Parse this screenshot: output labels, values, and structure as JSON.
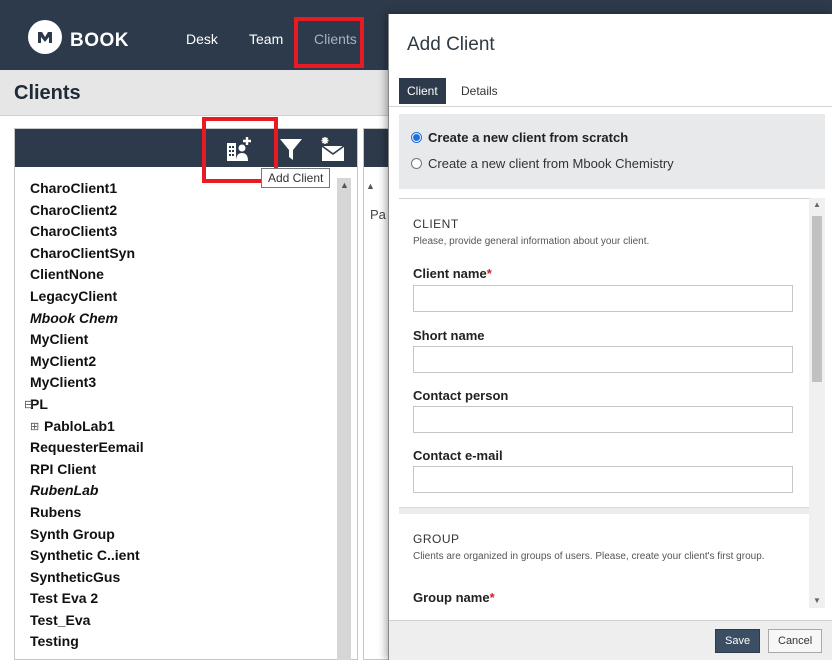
{
  "header": {
    "brand": "BOOK",
    "nav": [
      "Desk",
      "Team",
      "Clients"
    ]
  },
  "page": {
    "title": "Clients"
  },
  "toolbar": {
    "icons": [
      "add-client-icon",
      "filter-icon",
      "new-message-icon"
    ],
    "tooltip": "Add Client"
  },
  "clients": {
    "items": [
      {
        "label": "CharoClient1",
        "italic": false
      },
      {
        "label": "CharoClient2",
        "italic": false
      },
      {
        "label": "CharoClient3",
        "italic": false
      },
      {
        "label": "CharoClientSyn",
        "italic": false
      },
      {
        "label": "ClientNone",
        "italic": false
      },
      {
        "label": "LegacyClient",
        "italic": false
      },
      {
        "label": "Mbook Chem",
        "italic": true
      },
      {
        "label": "MyClient",
        "italic": false
      },
      {
        "label": "MyClient2",
        "italic": false
      },
      {
        "label": "MyClient3",
        "italic": false
      },
      {
        "label": "PL",
        "italic": false,
        "toggle": "⊟"
      },
      {
        "label": "PabloLab1",
        "italic": false,
        "toggle": "⊞",
        "child": true
      },
      {
        "label": "RequesterEemail",
        "italic": false
      },
      {
        "label": "RPI Client",
        "italic": false
      },
      {
        "label": "RubenLab",
        "italic": true
      },
      {
        "label": "Rubens",
        "italic": false
      },
      {
        "label": "Synth Group",
        "italic": false
      },
      {
        "label": "Synthetic C..ient",
        "italic": false
      },
      {
        "label": "SyntheticGus",
        "italic": false
      },
      {
        "label": "Test Eva 2",
        "italic": false
      },
      {
        "label": "Test_Eva",
        "italic": false
      },
      {
        "label": "Testing",
        "italic": false
      }
    ]
  },
  "middle_panel": {
    "text": "Pa"
  },
  "modal": {
    "title": "Add Client",
    "tabs": [
      "Client",
      "Details"
    ],
    "options": [
      {
        "label": "Create a new client from scratch",
        "checked": true
      },
      {
        "label": "Create a new client from Mbook Chemistry",
        "checked": false
      }
    ],
    "client_section": {
      "heading": "CLIENT",
      "description": "Please, provide general information about your client."
    },
    "fields": [
      {
        "label": "Client name",
        "required": true,
        "value": ""
      },
      {
        "label": "Short name",
        "required": false,
        "value": ""
      },
      {
        "label": "Contact person",
        "required": false,
        "value": ""
      },
      {
        "label": "Contact e-mail",
        "required": false,
        "value": ""
      }
    ],
    "group_section": {
      "heading": "GROUP",
      "description": "Clients are organized in groups of users. Please, create your client's first group.",
      "field_label": "Group name",
      "required": true
    },
    "buttons": {
      "save": "Save",
      "cancel": "Cancel"
    }
  },
  "colors": {
    "header_bg": "#2c3a4b",
    "highlight": "#e81a24",
    "active_nav": "#a7b3c2"
  }
}
